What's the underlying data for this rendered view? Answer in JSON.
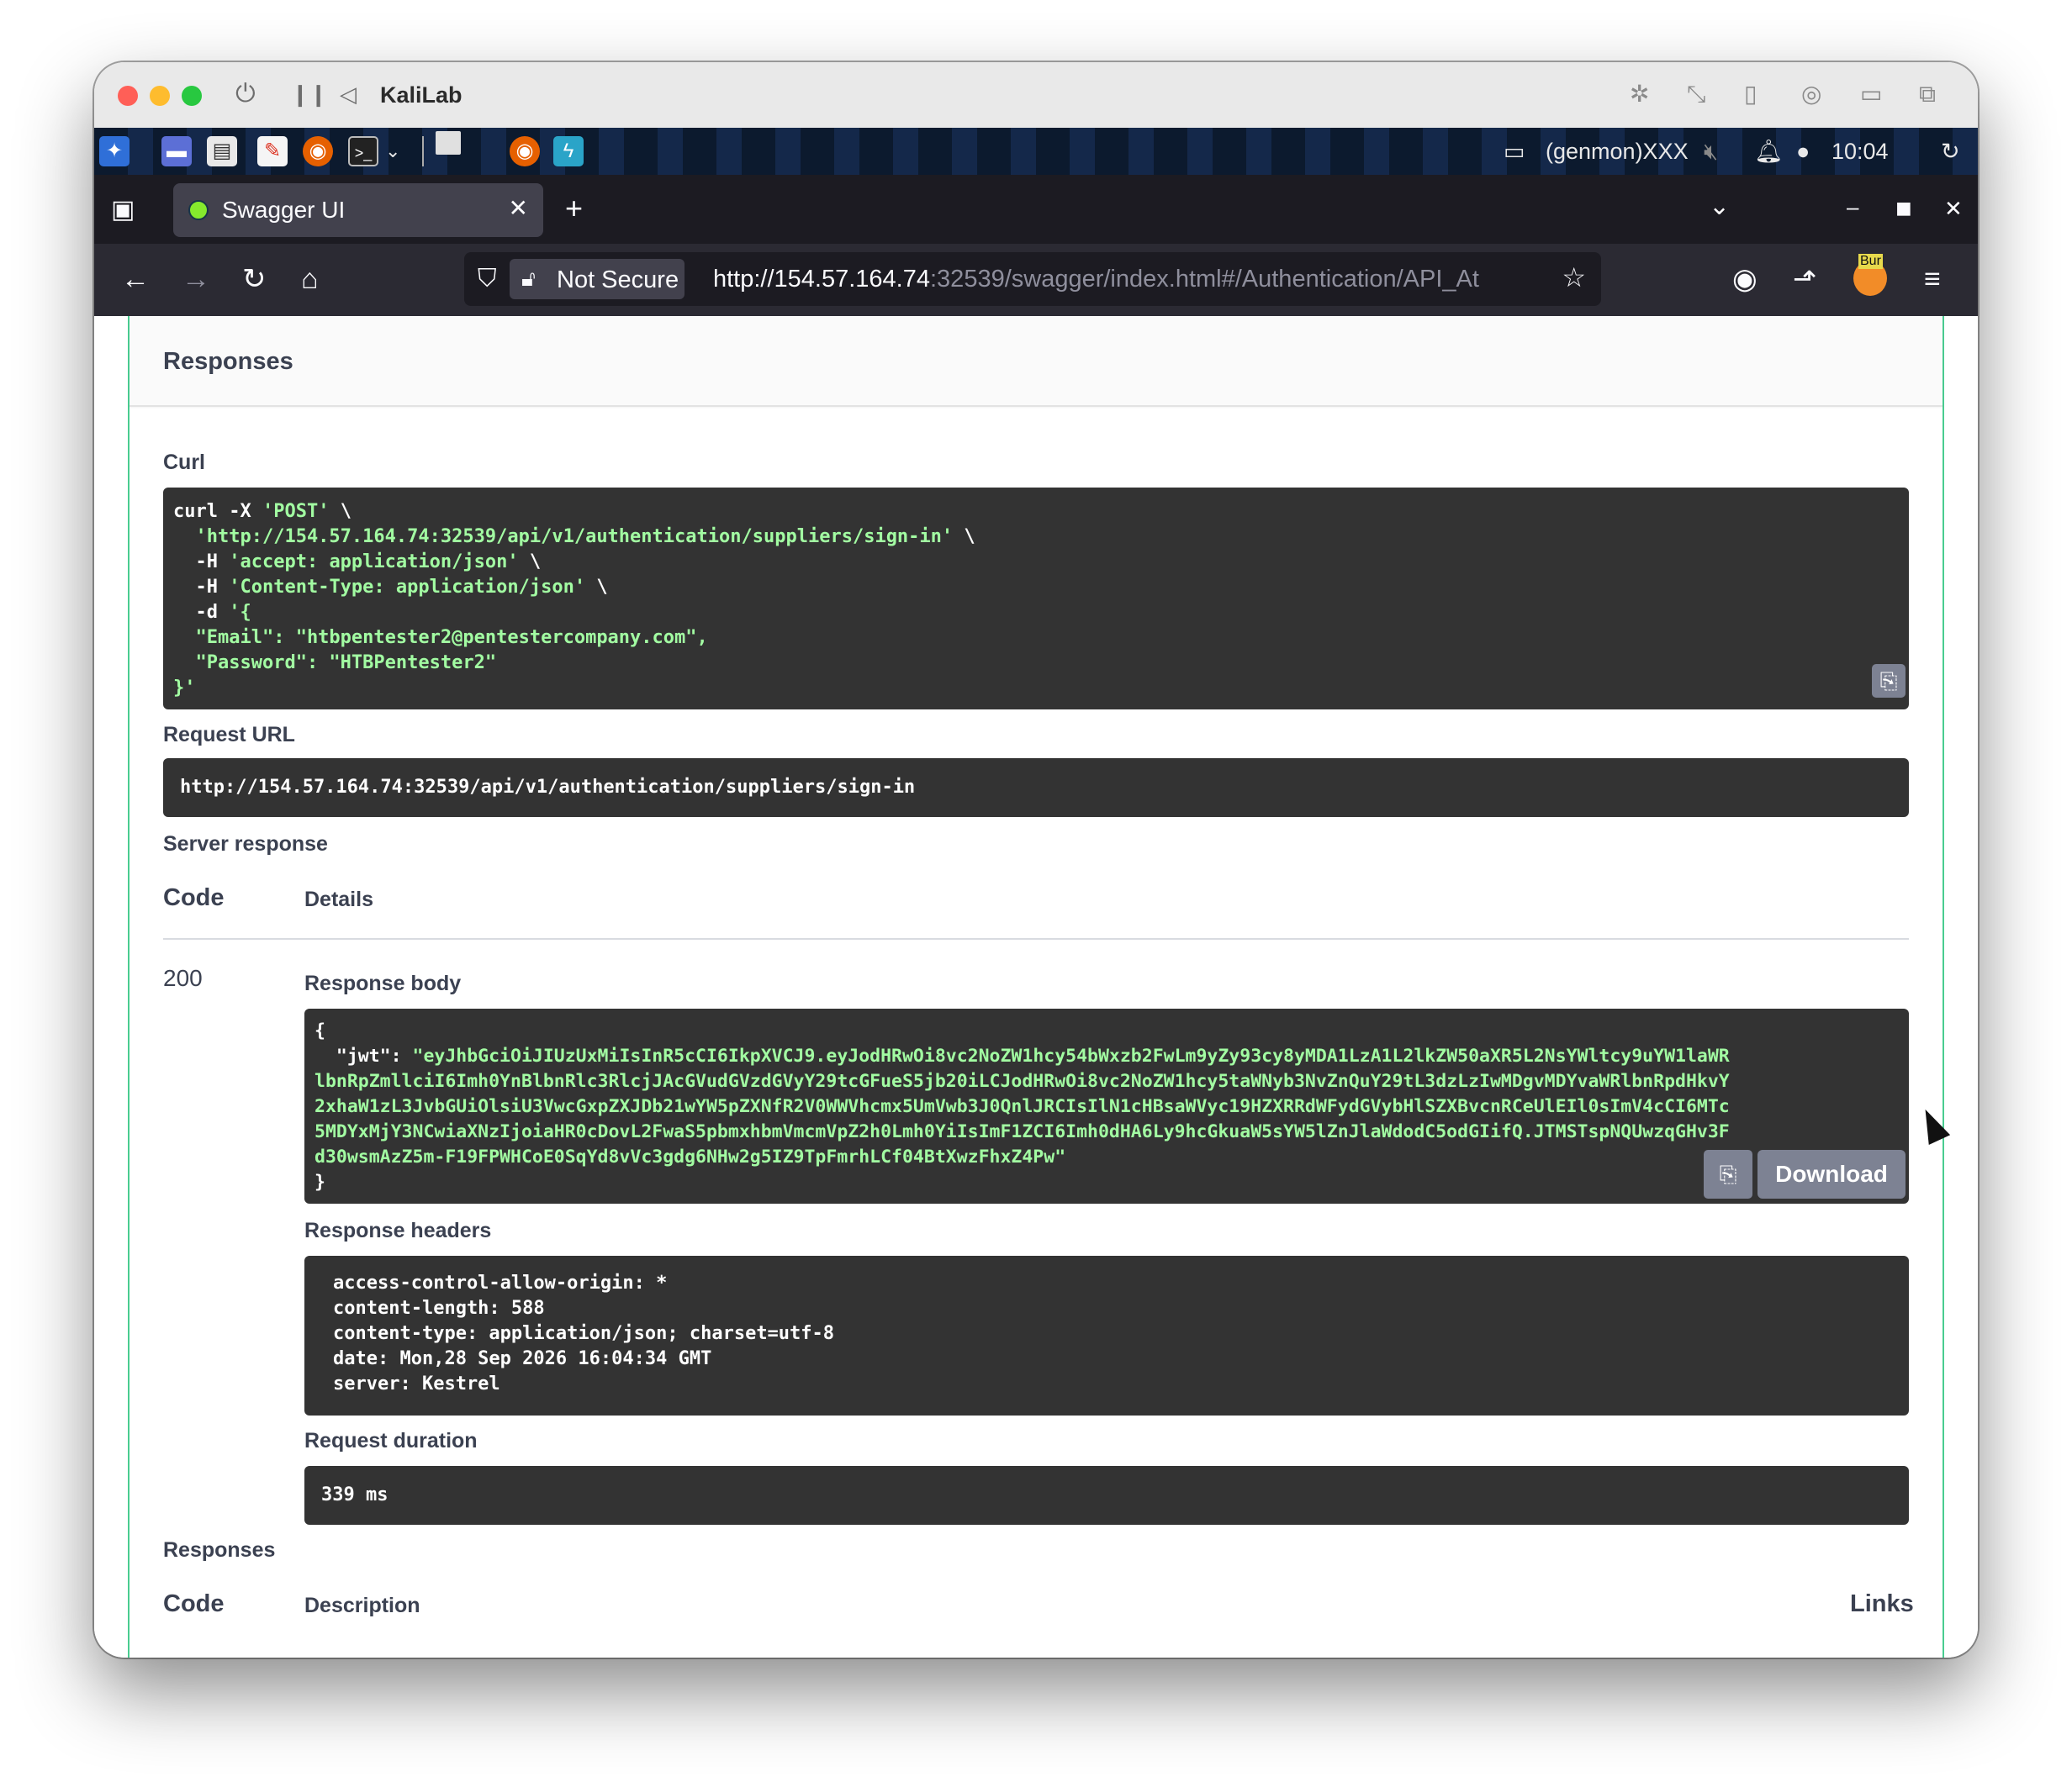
{
  "vm": {
    "title": "KaliLab"
  },
  "panel": {
    "status_text": "(genmon)XXX",
    "clock": "10:04"
  },
  "browser": {
    "tab_title": "Swagger UI",
    "not_secure": "Not Secure",
    "url_host": "http://154.57.164.74",
    "url_rest": ":32539/swagger/index.html#/Authentication/API_At",
    "extension_badge": "Bur"
  },
  "swagger": {
    "responses_title": "Responses",
    "curl_label": "Curl",
    "curl": {
      "line1_cmd": "curl -X ",
      "line1_method": "'POST'",
      "line1_end": " \\",
      "line2": "  'http://154.57.164.74:32539/api/v1/authentication/suppliers/sign-in'",
      "line2_end": " \\",
      "line3_flag": "  -H ",
      "line3_val": "'accept: application/json'",
      "line3_end": " \\",
      "line4_flag": "  -H ",
      "line4_val": "'Content-Type: application/json'",
      "line4_end": " \\",
      "line5_flag": "  -d ",
      "line5_val": "'{",
      "line6": "  \"Email\": \"htbpentester2@pentestercompany.com\",",
      "line7": "  \"Password\": \"HTBPentester2\"",
      "line8": "}'"
    },
    "request_url_label": "Request URL",
    "request_url": "http://154.57.164.74:32539/api/v1/authentication/suppliers/sign-in",
    "server_response_label": "Server response",
    "code_header": "Code",
    "details_header": "Details",
    "status_code": "200",
    "response_body_label": "Response body",
    "body": {
      "open": "{",
      "key": "  \"jwt\": ",
      "line1": "\"eyJhbGciOiJIUzUxMiIsInR5cCI6IkpXVCJ9.eyJodHRwOi8vc2NoZW1hcy54bWxzb2FwLm9yZy93cy8yMDA1LzA1L2lkZW50aXR5L2NsYWltcy9uYW1laWR",
      "line2": "lbnRpZmllciI6Imh0YnBlbnRlc3RlcjJAcGVudGVzdGVyY29tcGFueS5jb20iLCJodHRwOi8vc2NoZW1hcy5taWNyb3NvZnQuY29tL3dzLzIwMDgvMDYvaWRlbnRpdHkvY",
      "line3": "2xhaW1zL3JvbGUiOlsiU3VwcGxpZXJDb21wYW5pZXNfR2V0WWVhcmx5UmVwb3J0QnlJRCIsIlN1cHBsaWVyc19HZXRRdWFydGVybHlSZXBvcnRCeUlEIl0sImV4cCI6MTc",
      "line4": "5MDYxMjY3NCwiaXNzIjoiaHR0cDovL2FwaS5pbmxhbmVmcmVpZ2h0Lmh0YiIsImF1ZCI6Imh0dHA6Ly9hcGkuaW5sYW5lZnJlaWdodC5odGIifQ.JTMSTspNQUwzqGHv3F",
      "line5": "d30wsmAzZ5m-F19FPWHCoE0SqYd8vVc3gdg6NHw2g5IZ9TpFmrhLCf04BtXwzFhxZ4Pw\"",
      "close": "}"
    },
    "download_label": "Download",
    "response_headers_label": "Response headers",
    "headers": [
      "access-control-allow-origin: *",
      "content-length: 588",
      "content-type: application/json; charset=utf-8",
      "date: Mon,28 Sep 2026 16:04:34 GMT",
      "server: Kestrel"
    ],
    "request_duration_label": "Request duration",
    "request_duration": "339 ms",
    "responses2_label": "Responses",
    "code_header2": "Code",
    "description_header": "Description",
    "links_header": "Links"
  },
  "colors": {
    "accent_green": "#49cc90",
    "code_bg": "#333333",
    "code_string": "#a2fca2"
  }
}
